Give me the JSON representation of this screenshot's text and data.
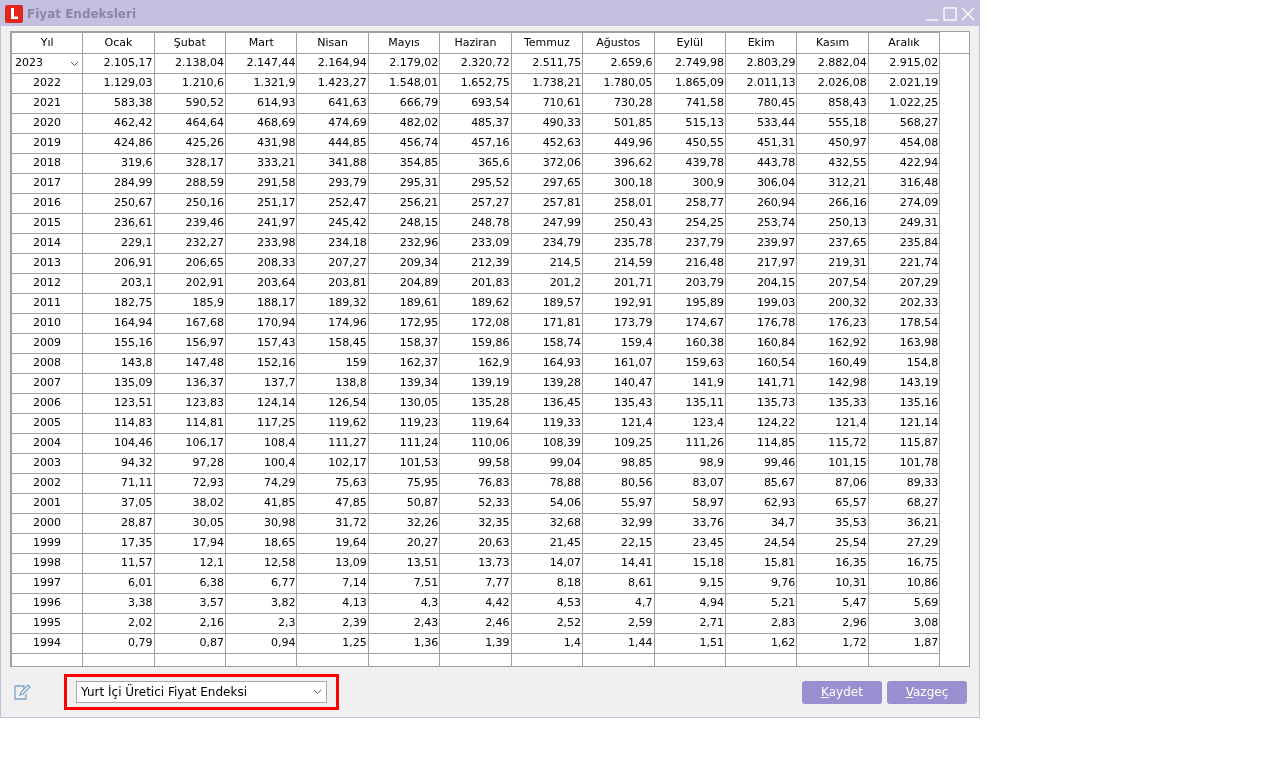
{
  "window": {
    "title": "Fiyat Endeksleri"
  },
  "table": {
    "columns": [
      "Yıl",
      "Ocak",
      "Şubat",
      "Mart",
      "Nisan",
      "Mayıs",
      "Haziran",
      "Temmuz",
      "Ağustos",
      "Eylül",
      "Ekim",
      "Kasım",
      "Aralık"
    ],
    "rows": [
      {
        "year": "2023",
        "editing": true,
        "values": [
          "2.105,17",
          "2.138,04",
          "2.147,44",
          "2.164,94",
          "2.179,02",
          "2.320,72",
          "2.511,75",
          "2.659,6",
          "2.749,98",
          "2.803,29",
          "2.882,04",
          "2.915,02"
        ]
      },
      {
        "year": "2022",
        "editing": false,
        "values": [
          "1.129,03",
          "1.210,6",
          "1.321,9",
          "1.423,27",
          "1.548,01",
          "1.652,75",
          "1.738,21",
          "1.780,05",
          "1.865,09",
          "2.011,13",
          "2.026,08",
          "2.021,19"
        ]
      },
      {
        "year": "2021",
        "editing": false,
        "values": [
          "583,38",
          "590,52",
          "614,93",
          "641,63",
          "666,79",
          "693,54",
          "710,61",
          "730,28",
          "741,58",
          "780,45",
          "858,43",
          "1.022,25"
        ]
      },
      {
        "year": "2020",
        "editing": false,
        "values": [
          "462,42",
          "464,64",
          "468,69",
          "474,69",
          "482,02",
          "485,37",
          "490,33",
          "501,85",
          "515,13",
          "533,44",
          "555,18",
          "568,27"
        ]
      },
      {
        "year": "2019",
        "editing": false,
        "values": [
          "424,86",
          "425,26",
          "431,98",
          "444,85",
          "456,74",
          "457,16",
          "452,63",
          "449,96",
          "450,55",
          "451,31",
          "450,97",
          "454,08"
        ]
      },
      {
        "year": "2018",
        "editing": false,
        "values": [
          "319,6",
          "328,17",
          "333,21",
          "341,88",
          "354,85",
          "365,6",
          "372,06",
          "396,62",
          "439,78",
          "443,78",
          "432,55",
          "422,94"
        ]
      },
      {
        "year": "2017",
        "editing": false,
        "values": [
          "284,99",
          "288,59",
          "291,58",
          "293,79",
          "295,31",
          "295,52",
          "297,65",
          "300,18",
          "300,9",
          "306,04",
          "312,21",
          "316,48"
        ]
      },
      {
        "year": "2016",
        "editing": false,
        "values": [
          "250,67",
          "250,16",
          "251,17",
          "252,47",
          "256,21",
          "257,27",
          "257,81",
          "258,01",
          "258,77",
          "260,94",
          "266,16",
          "274,09"
        ]
      },
      {
        "year": "2015",
        "editing": false,
        "values": [
          "236,61",
          "239,46",
          "241,97",
          "245,42",
          "248,15",
          "248,78",
          "247,99",
          "250,43",
          "254,25",
          "253,74",
          "250,13",
          "249,31"
        ]
      },
      {
        "year": "2014",
        "editing": false,
        "values": [
          "229,1",
          "232,27",
          "233,98",
          "234,18",
          "232,96",
          "233,09",
          "234,79",
          "235,78",
          "237,79",
          "239,97",
          "237,65",
          "235,84"
        ]
      },
      {
        "year": "2013",
        "editing": false,
        "values": [
          "206,91",
          "206,65",
          "208,33",
          "207,27",
          "209,34",
          "212,39",
          "214,5",
          "214,59",
          "216,48",
          "217,97",
          "219,31",
          "221,74"
        ]
      },
      {
        "year": "2012",
        "editing": false,
        "values": [
          "203,1",
          "202,91",
          "203,64",
          "203,81",
          "204,89",
          "201,83",
          "201,2",
          "201,71",
          "203,79",
          "204,15",
          "207,54",
          "207,29"
        ]
      },
      {
        "year": "2011",
        "editing": false,
        "values": [
          "182,75",
          "185,9",
          "188,17",
          "189,32",
          "189,61",
          "189,62",
          "189,57",
          "192,91",
          "195,89",
          "199,03",
          "200,32",
          "202,33"
        ]
      },
      {
        "year": "2010",
        "editing": false,
        "values": [
          "164,94",
          "167,68",
          "170,94",
          "174,96",
          "172,95",
          "172,08",
          "171,81",
          "173,79",
          "174,67",
          "176,78",
          "176,23",
          "178,54"
        ]
      },
      {
        "year": "2009",
        "editing": false,
        "values": [
          "155,16",
          "156,97",
          "157,43",
          "158,45",
          "158,37",
          "159,86",
          "158,74",
          "159,4",
          "160,38",
          "160,84",
          "162,92",
          "163,98"
        ]
      },
      {
        "year": "2008",
        "editing": false,
        "values": [
          "143,8",
          "147,48",
          "152,16",
          "159",
          "162,37",
          "162,9",
          "164,93",
          "161,07",
          "159,63",
          "160,54",
          "160,49",
          "154,8"
        ]
      },
      {
        "year": "2007",
        "editing": false,
        "values": [
          "135,09",
          "136,37",
          "137,7",
          "138,8",
          "139,34",
          "139,19",
          "139,28",
          "140,47",
          "141,9",
          "141,71",
          "142,98",
          "143,19"
        ]
      },
      {
        "year": "2006",
        "editing": false,
        "values": [
          "123,51",
          "123,83",
          "124,14",
          "126,54",
          "130,05",
          "135,28",
          "136,45",
          "135,43",
          "135,11",
          "135,73",
          "135,33",
          "135,16"
        ]
      },
      {
        "year": "2005",
        "editing": false,
        "values": [
          "114,83",
          "114,81",
          "117,25",
          "119,62",
          "119,23",
          "119,64",
          "119,33",
          "121,4",
          "123,4",
          "124,22",
          "121,4",
          "121,14"
        ]
      },
      {
        "year": "2004",
        "editing": false,
        "values": [
          "104,46",
          "106,17",
          "108,4",
          "111,27",
          "111,24",
          "110,06",
          "108,39",
          "109,25",
          "111,26",
          "114,85",
          "115,72",
          "115,87"
        ]
      },
      {
        "year": "2003",
        "editing": false,
        "values": [
          "94,32",
          "97,28",
          "100,4",
          "102,17",
          "101,53",
          "99,58",
          "99,04",
          "98,85",
          "98,9",
          "99,46",
          "101,15",
          "101,78"
        ]
      },
      {
        "year": "2002",
        "editing": false,
        "values": [
          "71,11",
          "72,93",
          "74,29",
          "75,63",
          "75,95",
          "76,83",
          "78,88",
          "80,56",
          "83,07",
          "85,67",
          "87,06",
          "89,33"
        ]
      },
      {
        "year": "2001",
        "editing": false,
        "values": [
          "37,05",
          "38,02",
          "41,85",
          "47,85",
          "50,87",
          "52,33",
          "54,06",
          "55,97",
          "58,97",
          "62,93",
          "65,57",
          "68,27"
        ]
      },
      {
        "year": "2000",
        "editing": false,
        "values": [
          "28,87",
          "30,05",
          "30,98",
          "31,72",
          "32,26",
          "32,35",
          "32,68",
          "32,99",
          "33,76",
          "34,7",
          "35,53",
          "36,21"
        ]
      },
      {
        "year": "1999",
        "editing": false,
        "values": [
          "17,35",
          "17,94",
          "18,65",
          "19,64",
          "20,27",
          "20,63",
          "21,45",
          "22,15",
          "23,45",
          "24,54",
          "25,54",
          "27,29"
        ]
      },
      {
        "year": "1998",
        "editing": false,
        "values": [
          "11,57",
          "12,1",
          "12,58",
          "13,09",
          "13,51",
          "13,73",
          "14,07",
          "14,41",
          "15,18",
          "15,81",
          "16,35",
          "16,75"
        ]
      },
      {
        "year": "1997",
        "editing": false,
        "values": [
          "6,01",
          "6,38",
          "6,77",
          "7,14",
          "7,51",
          "7,77",
          "8,18",
          "8,61",
          "9,15",
          "9,76",
          "10,31",
          "10,86"
        ]
      },
      {
        "year": "1996",
        "editing": false,
        "values": [
          "3,38",
          "3,57",
          "3,82",
          "4,13",
          "4,3",
          "4,42",
          "4,53",
          "4,7",
          "4,94",
          "5,21",
          "5,47",
          "5,69"
        ]
      },
      {
        "year": "1995",
        "editing": false,
        "values": [
          "2,02",
          "2,16",
          "2,3",
          "2,39",
          "2,43",
          "2,46",
          "2,52",
          "2,59",
          "2,71",
          "2,83",
          "2,96",
          "3,08"
        ]
      },
      {
        "year": "1994",
        "editing": false,
        "values": [
          "0,79",
          "0,87",
          "0,94",
          "1,25",
          "1,36",
          "1,39",
          "1,4",
          "1,44",
          "1,51",
          "1,62",
          "1,72",
          "1,87"
        ]
      }
    ]
  },
  "index_type": {
    "value": "Yurt İçi Üretici Fiyat Endeksi"
  },
  "buttons": [
    "Kaydet",
    "Vazgeç"
  ]
}
